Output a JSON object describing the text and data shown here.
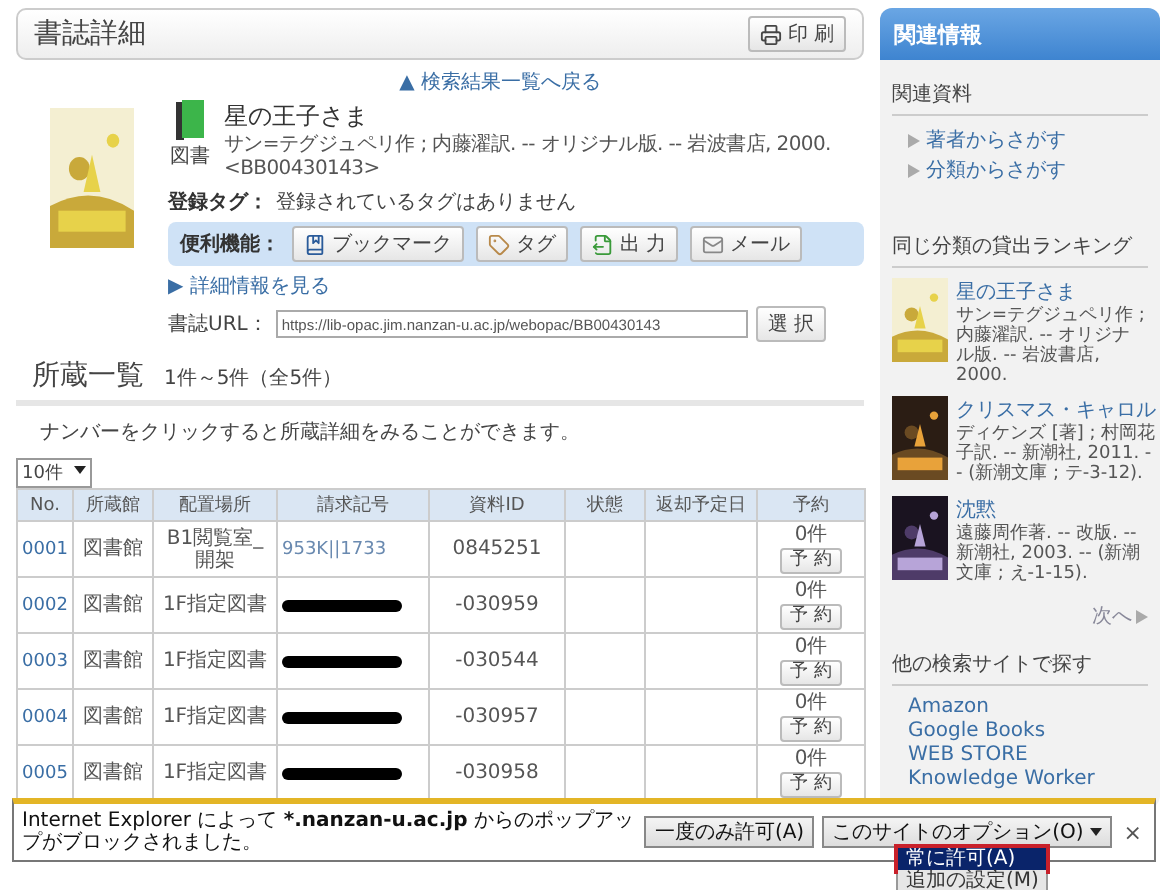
{
  "header": {
    "title": "書誌詳細",
    "print_button": "印 刷"
  },
  "back_link": "▲ 検索結果一覧へ戻る",
  "book": {
    "kind_label": "図書",
    "title": "星の王子さま",
    "description": "サン=テグジュペリ作 ; 内藤濯訳. -- オリジナル版. -- 岩波書店, 2000.",
    "id": "<BB00430143>"
  },
  "tags": {
    "label": "登録タグ：",
    "value": "登録されているタグはありません"
  },
  "tools": {
    "label": "便利機能：",
    "buttons": [
      {
        "kind": "bookmark",
        "label": "ブックマーク"
      },
      {
        "kind": "tag",
        "label": "タグ"
      },
      {
        "kind": "output",
        "label": "出 力"
      },
      {
        "kind": "mail",
        "label": "メール"
      }
    ]
  },
  "detail_link": "▶ 詳細情報を見る",
  "url": {
    "label": "書誌URL：",
    "value": "https://lib-opac.jim.nanzan-u.ac.jp/webopac/BB00430143",
    "button": "選 択"
  },
  "holdings": {
    "title": "所蔵一覧",
    "count": "1件～5件（全5件）",
    "hint": "ナンバーをクリックすると所蔵詳細をみることができます。",
    "page_size": "10件",
    "columns": [
      "No.",
      "所蔵館",
      "配置場所",
      "請求記号",
      "資料ID",
      "状態",
      "返却予定日",
      "予約"
    ],
    "rows": [
      {
        "no": "0001",
        "library": "図書館",
        "location": "B1閲覧室_開架",
        "call_number": "953K||1733",
        "redacted": false,
        "item_id": "0845251",
        "reservations": "0件",
        "reserve_button": "予 約"
      },
      {
        "no": "0002",
        "library": "図書館",
        "location": "1F指定図書",
        "redacted": true,
        "item_id": "-030959",
        "reservations": "0件",
        "reserve_button": "予 約"
      },
      {
        "no": "0003",
        "library": "図書館",
        "location": "1F指定図書",
        "redacted": true,
        "item_id": "-030544",
        "reservations": "0件",
        "reserve_button": "予 約"
      },
      {
        "no": "0004",
        "library": "図書館",
        "location": "1F指定図書",
        "redacted": true,
        "item_id": "-030957",
        "reservations": "0件",
        "reserve_button": "予 約"
      },
      {
        "no": "0005",
        "library": "図書館",
        "location": "1F指定図書",
        "redacted": true,
        "item_id": "-030958",
        "reservations": "0件",
        "reserve_button": "予 約"
      }
    ]
  },
  "sidebar": {
    "title": "関連情報",
    "related": {
      "heading": "関連資料",
      "links": [
        "著者からさがす",
        "分類からさがす"
      ]
    },
    "ranking": {
      "heading": "同じ分類の貸出ランキング",
      "items": [
        {
          "title": "星の王子さま",
          "description": "サン=テグジュペリ作 ; 内藤濯訳. -- オリジナル版. -- 岩波書店, 2000."
        },
        {
          "title": "クリスマス・キャロル",
          "description": "ディケンズ [著] ; 村岡花子訳. -- 新潮社, 2011. -- (新潮文庫 ; テ-3-12)."
        },
        {
          "title": "沈黙",
          "description": "遠藤周作著. -- 改版. -- 新潮社, 2003. -- (新潮文庫 ; え-1-15)."
        }
      ],
      "next": "次へ"
    },
    "other": {
      "heading": "他の検索サイトで探す",
      "links": [
        "Amazon",
        "Google Books",
        "WEB STORE",
        "Knowledge Worker"
      ]
    }
  },
  "popup": {
    "message": {
      "before": "Internet Explorer によって ",
      "bold": "*.nanzan-u.ac.jp",
      "after": " からのポップアップがブロックされました。"
    },
    "allow_once": "一度のみ許可(A)",
    "options": "このサイトのオプション(O)",
    "close": "×",
    "menu": [
      {
        "label": "常に許可(A)",
        "selected": true
      },
      {
        "label": "追加の設定(M)",
        "selected": false
      }
    ]
  }
}
